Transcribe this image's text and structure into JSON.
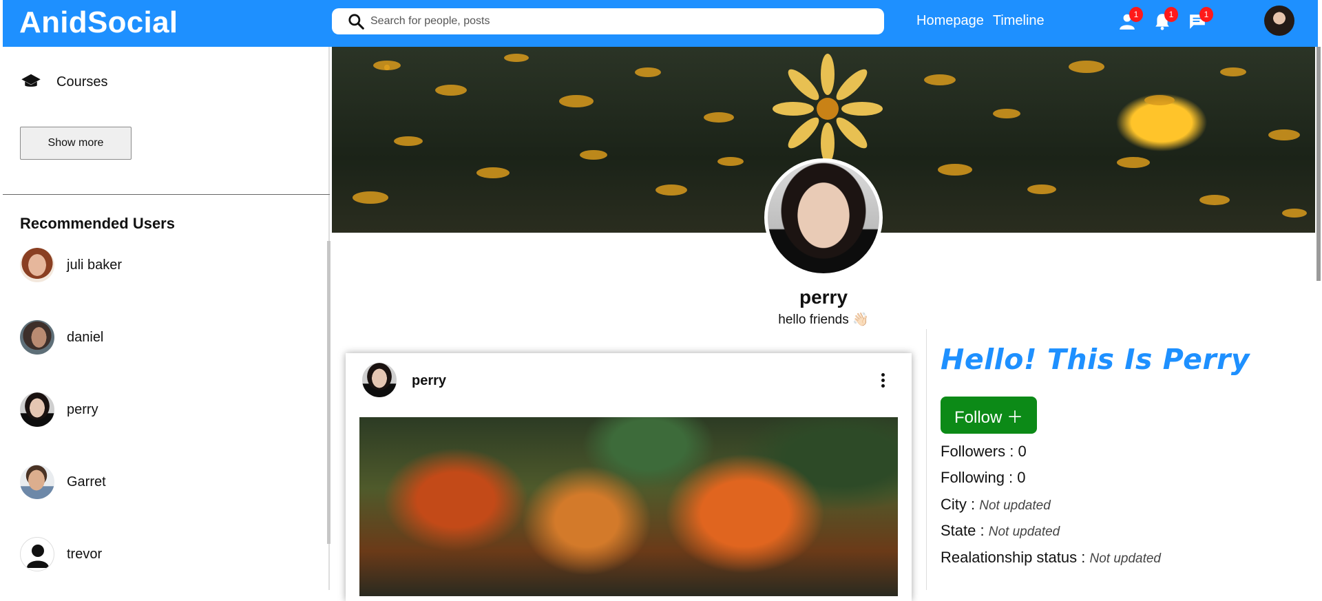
{
  "header": {
    "logo": "AnidSocial",
    "search_placeholder": "Search for people, posts",
    "links": [
      "Homepage",
      "Timeline"
    ],
    "icons": [
      {
        "name": "person-icon",
        "badge": "1"
      },
      {
        "name": "bell-icon",
        "badge": "1"
      },
      {
        "name": "chat-icon",
        "badge": "1"
      }
    ]
  },
  "sidebar": {
    "item_courses": "Courses",
    "show_more": "Show more",
    "recommended_title": "Recommended Users",
    "users": [
      "juli baker",
      "daniel",
      "perry",
      "Garret",
      "trevor"
    ]
  },
  "profile": {
    "name": "perry",
    "bio": "hello friends 👋🏻"
  },
  "post": {
    "username": "perry"
  },
  "info": {
    "title": "Hello! This Is Perry",
    "follow_label": "Follow ＋",
    "followers_label": "Followers : 0",
    "following_label": "Following : 0",
    "city_label": "City : ",
    "city_value": "Not updated",
    "state_label": "State : ",
    "state_value": "Not updated",
    "relationship_label": "Realationship status : ",
    "relationship_value": "Not updated"
  },
  "colors": {
    "brand": "#1e90ff",
    "follow": "#0c8a17",
    "badge": "#ff1a1a"
  }
}
